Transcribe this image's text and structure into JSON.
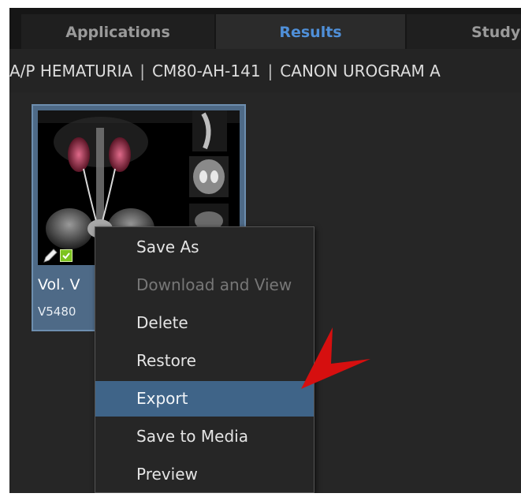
{
  "tabs": [
    {
      "label": "Applications",
      "active": false
    },
    {
      "label": "Results",
      "active": true
    },
    {
      "label": "Study",
      "active": false
    }
  ],
  "breadcrumb": {
    "parts": [
      "A/P HEMATURIA",
      "CM80-AH-141",
      "CANON UROGRAM A"
    ]
  },
  "series": {
    "title": "Vol. V",
    "subtitle": "V5480",
    "status_icons": [
      "edit-icon",
      "checked-icon"
    ]
  },
  "context_menu": {
    "items": [
      {
        "label": "Save As",
        "enabled": true,
        "highlighted": false
      },
      {
        "label": "Download and View",
        "enabled": false,
        "highlighted": false
      },
      {
        "label": "Delete",
        "enabled": true,
        "highlighted": false
      },
      {
        "label": "Restore",
        "enabled": true,
        "highlighted": false
      },
      {
        "label": "Export",
        "enabled": true,
        "highlighted": true
      },
      {
        "label": "Save to Media",
        "enabled": true,
        "highlighted": false
      },
      {
        "label": "Preview",
        "enabled": true,
        "highlighted": false
      }
    ]
  },
  "colors": {
    "accent_tab_text": "#4f8fd8",
    "menu_highlight": "#3f6488",
    "annotation_arrow": "#d60f0f",
    "status_check": "#7cc31f"
  }
}
